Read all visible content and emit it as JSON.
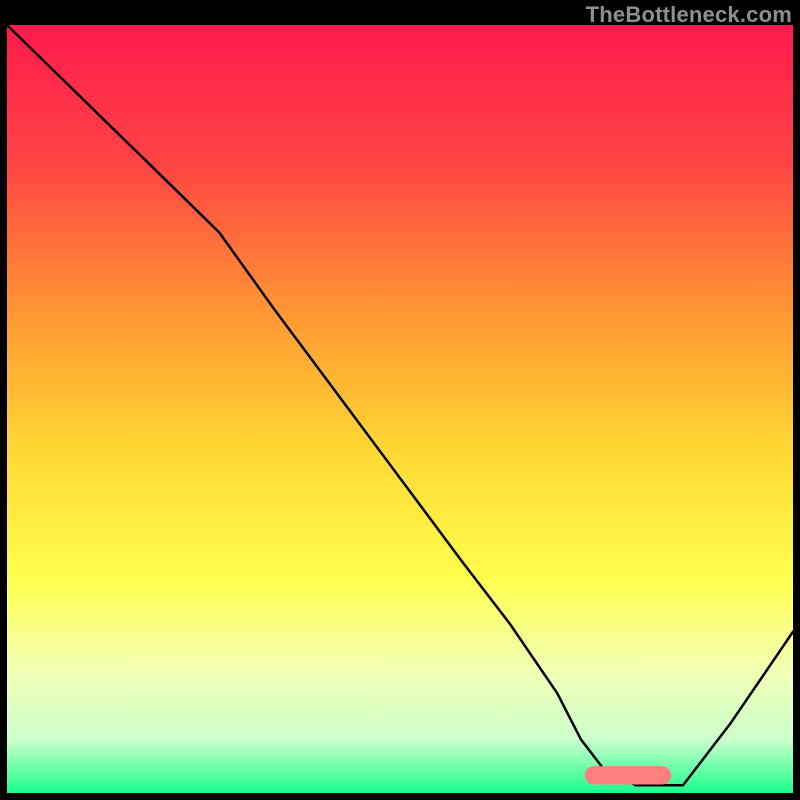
{
  "watermark": "TheBottleneck.com",
  "chart_data": {
    "type": "line",
    "title": "",
    "xlabel": "",
    "ylabel": "",
    "xlim": [
      0,
      100
    ],
    "ylim": [
      0,
      100
    ],
    "grid": false,
    "legend": false,
    "background_gradient_stops": [
      {
        "offset": 0.0,
        "color": "#ff1a4d"
      },
      {
        "offset": 0.18,
        "color": "#ff4444"
      },
      {
        "offset": 0.38,
        "color": "#ff9933"
      },
      {
        "offset": 0.55,
        "color": "#ffd633"
      },
      {
        "offset": 0.72,
        "color": "#ffff4d"
      },
      {
        "offset": 0.84,
        "color": "#f2ffb3"
      },
      {
        "offset": 0.93,
        "color": "#ccffcc"
      },
      {
        "offset": 1.0,
        "color": "#1aff8c"
      }
    ],
    "series": [
      {
        "name": "bottleneck-curve",
        "type": "line",
        "stroke": "#000000",
        "stroke_width": 2.5,
        "x": [
          0,
          6,
          12,
          18,
          24,
          27,
          34,
          42,
          50,
          58,
          64,
          70,
          73,
          76,
          80,
          86,
          92,
          98,
          100
        ],
        "y": [
          100,
          94,
          88,
          82,
          76,
          73,
          63,
          52,
          41,
          30,
          22,
          13,
          7,
          3,
          1,
          1,
          9,
          18,
          21
        ]
      }
    ],
    "marker": {
      "name": "optimal-range",
      "shape": "rounded-bar",
      "color": "#ff7f7f",
      "x_center": 79,
      "y_center": 2.3,
      "width": 11,
      "height": 2.4
    }
  }
}
